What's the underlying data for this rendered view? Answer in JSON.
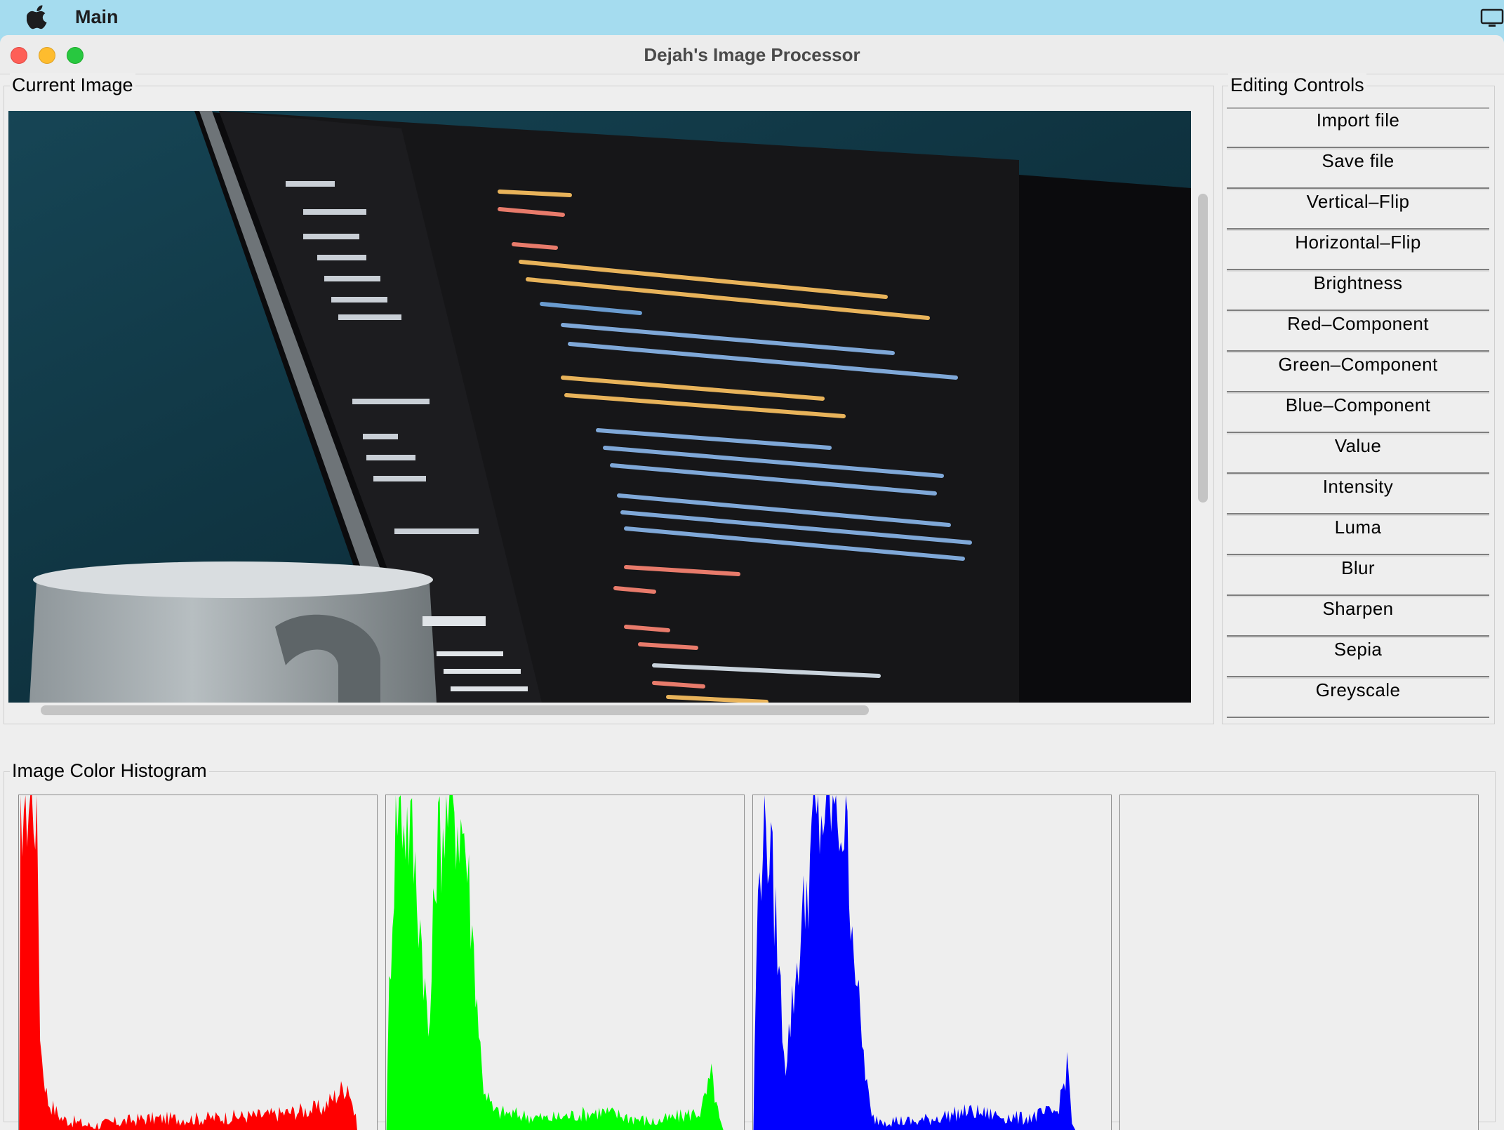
{
  "menubar": {
    "app_name": "Main",
    "apple_icon": "apple-icon",
    "screen_icon": "display-icon"
  },
  "window": {
    "title": "Dejah's Image Processor",
    "controls": [
      "close",
      "minimize",
      "maximize"
    ]
  },
  "current_image": {
    "label": "Current Image"
  },
  "editing_controls": {
    "label": "Editing Controls",
    "buttons": [
      "Import file",
      "Save file",
      "Vertical–Flip",
      "Horizontal–Flip",
      "Brightness",
      "Red–Component",
      "Green–Component",
      "Blue–Component",
      "Value",
      "Intensity",
      "Luma",
      "Blur",
      "Sharpen",
      "Sepia",
      "Greyscale"
    ]
  },
  "histogram": {
    "label": "Image Color Histogram",
    "panels": [
      {
        "channel": "red",
        "color": "#ff0000"
      },
      {
        "channel": "green",
        "color": "#00ff00"
      },
      {
        "channel": "blue",
        "color": "#0000ff"
      },
      {
        "channel": "intensity",
        "color": "#888888"
      }
    ]
  }
}
